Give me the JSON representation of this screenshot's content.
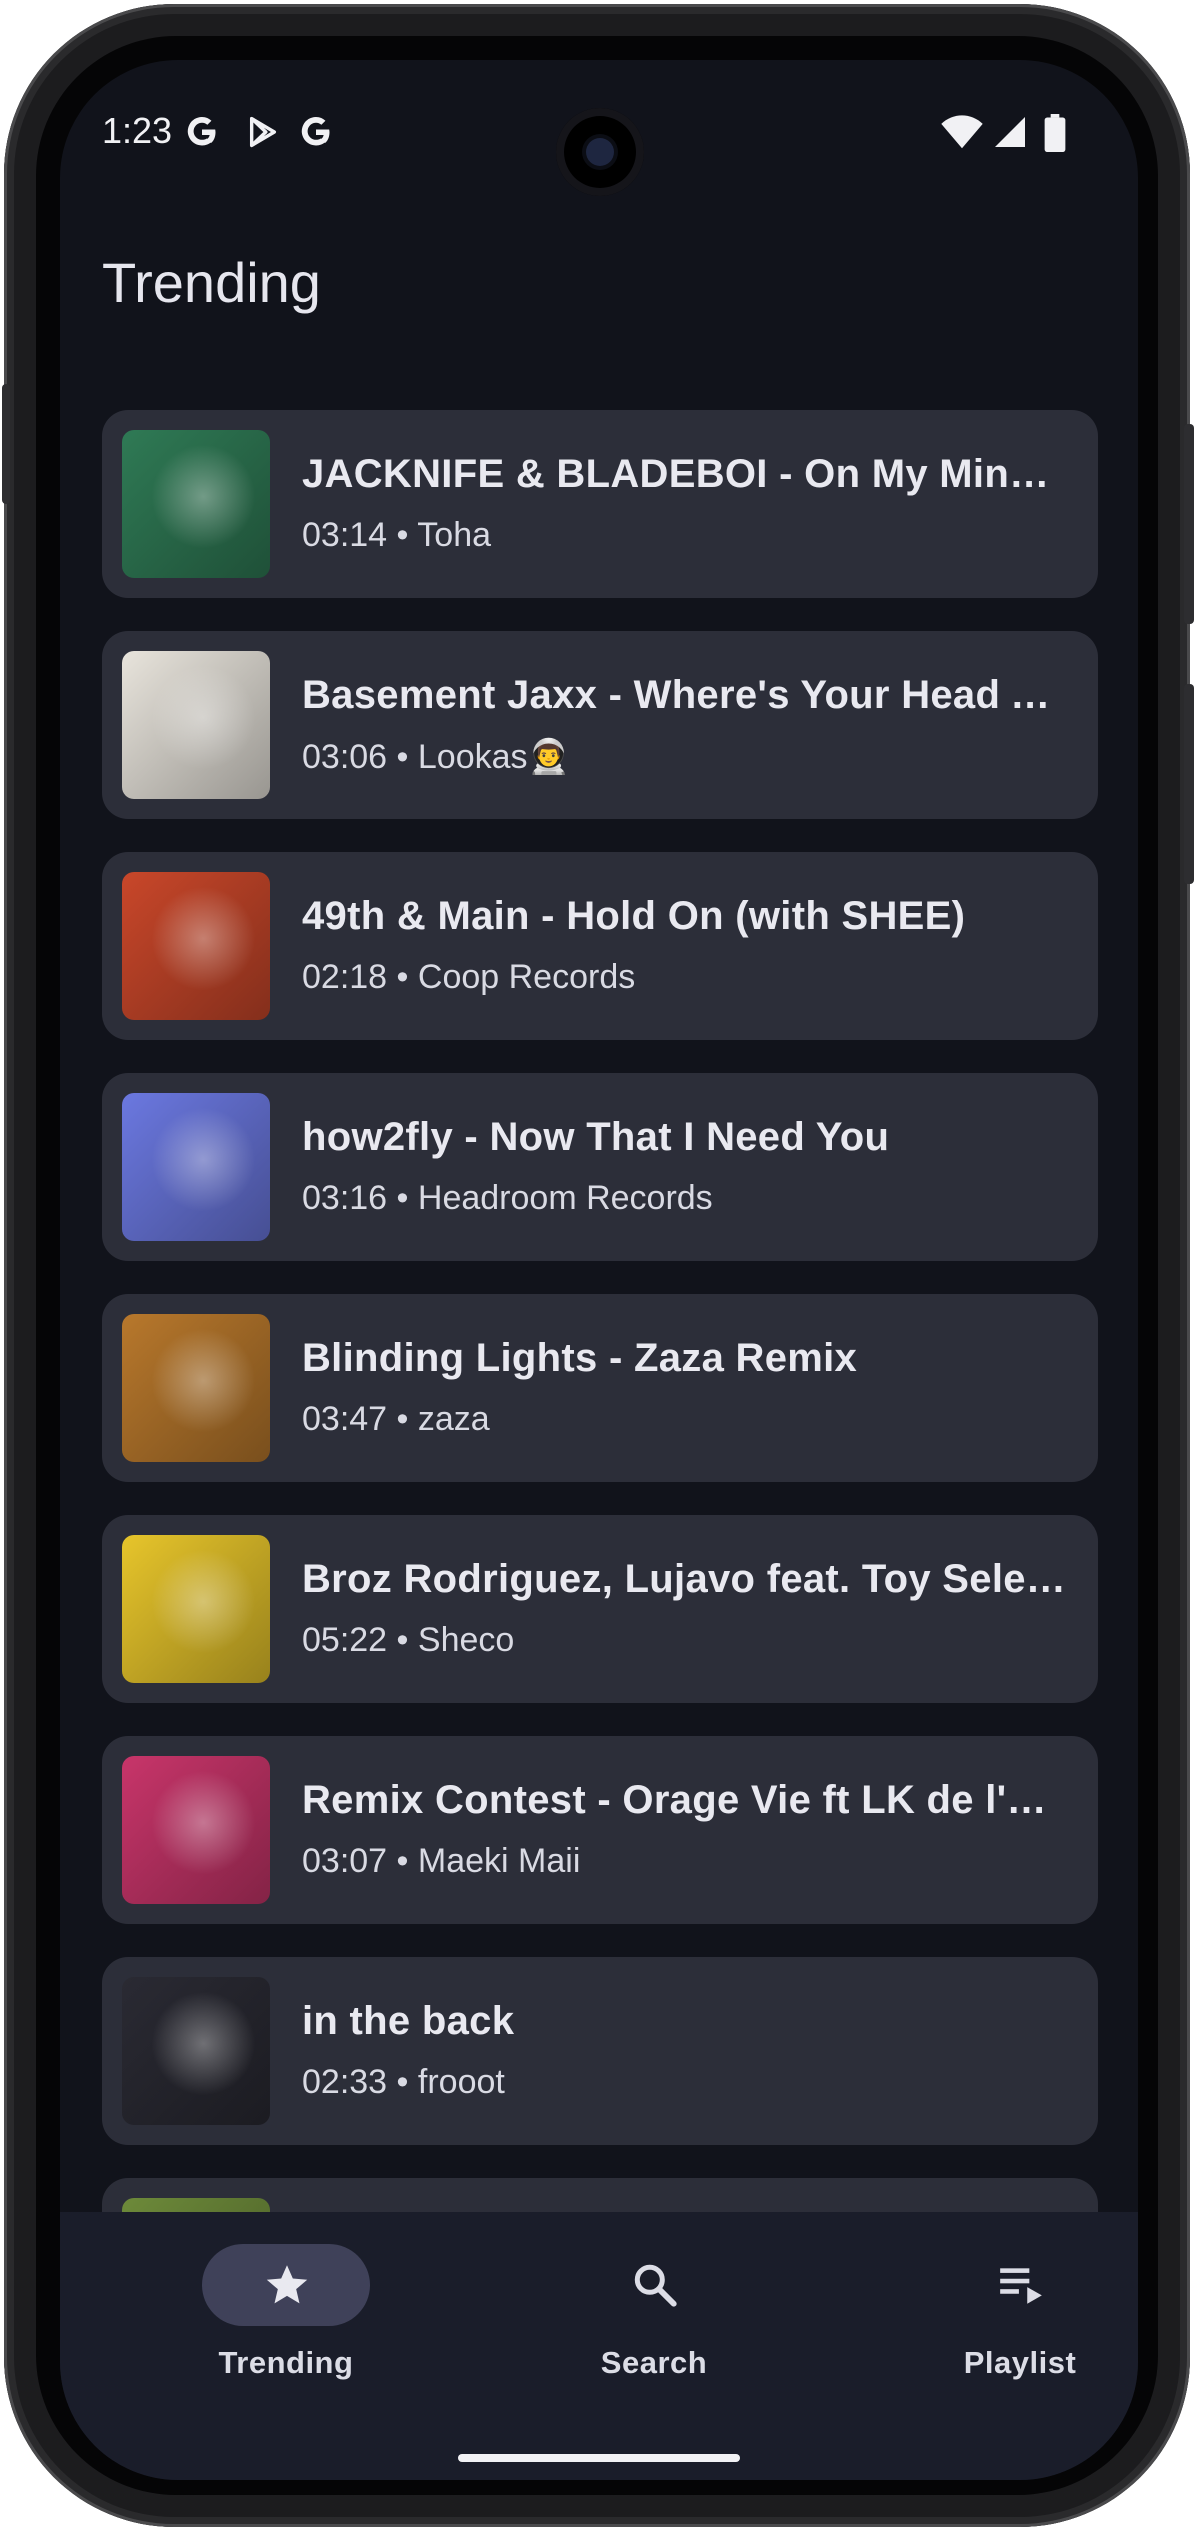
{
  "status_bar": {
    "time": "1:23",
    "left_icons": [
      "google-g-icon",
      "play-store-icon",
      "google-g-icon"
    ],
    "right_icons": [
      "wifi-icon",
      "cellular-signal-icon",
      "battery-icon"
    ]
  },
  "header": {
    "title": "Trending"
  },
  "tracks": [
    {
      "title": "JACKNIFE & BLADEBOI - On My Mind (Extended Mix)",
      "duration": "03:14",
      "artist": "Toha",
      "art_color": "#2f7a55"
    },
    {
      "title": "Basement Jaxx - Where's Your Head At (Lookas Remix)",
      "duration": "03:06",
      "artist": "Lookas👨‍🚀",
      "art_color": "#e8e4dc"
    },
    {
      "title": "49th & Main - Hold On (with SHEE)",
      "duration": "02:18",
      "artist": "Coop Records",
      "art_color": "#c9472a"
    },
    {
      "title": "how2fly - Now That I Need You",
      "duration": "03:16",
      "artist": "Headroom Records",
      "art_color": "#6b78e0"
    },
    {
      "title": "Blinding Lights - Zaza Remix",
      "duration": "03:47",
      "artist": "zaza",
      "art_color": "#b8782c"
    },
    {
      "title": "Broz Rodriguez, Lujavo feat. Toy Selectah - One Day With A Mexican",
      "duration": "05:22",
      "artist": "Sheco",
      "art_color": "#e7c52b"
    },
    {
      "title": "Remix Contest - Orage Vie ft LK de l'Hôtel Mort",
      "duration": "03:07",
      "artist": "Maeki Maii",
      "art_color": "#c8356a"
    },
    {
      "title": "in the back",
      "duration": "02:33",
      "artist": "frooot",
      "art_color": "#2a2a33"
    },
    {
      "title": "",
      "duration": "",
      "artist": "",
      "art_color": "#6d8a3a"
    }
  ],
  "bottom_nav": {
    "items": [
      {
        "label": "Trending",
        "icon": "star-icon",
        "active": true
      },
      {
        "label": "Search",
        "icon": "search-icon",
        "active": false
      },
      {
        "label": "Playlist",
        "icon": "playlist-play-icon",
        "active": false
      }
    ]
  },
  "colors": {
    "background": "#11131b",
    "card": "#2c2e39",
    "nav_background": "#1a1d2a",
    "nav_active_pill": "#3f4159",
    "text_primary": "#e9e9f0"
  }
}
